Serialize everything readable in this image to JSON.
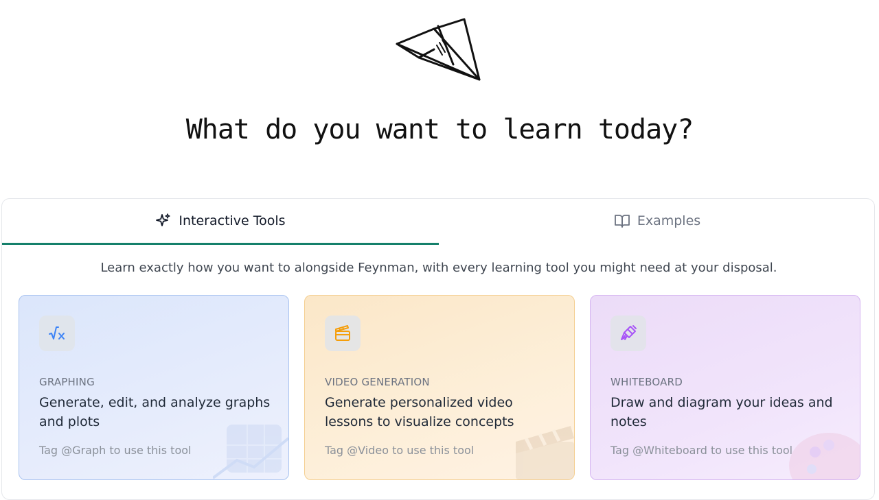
{
  "headline": "What do you want to learn today?",
  "tabs": [
    {
      "label": "Interactive Tools",
      "icon": "sparkles-icon",
      "active": true
    },
    {
      "label": "Examples",
      "icon": "open-book-icon",
      "active": false
    }
  ],
  "intro": "Learn exactly how you want to alongside Feynman, with every learning tool you might need at your disposal.",
  "cards": [
    {
      "label": "GRAPHING",
      "description": "Generate, edit, and analyze graphs and plots",
      "tag": "Tag @Graph to use this tool",
      "icon": "square-root-icon",
      "accent": "#3b82f6"
    },
    {
      "label": "VIDEO GENERATION",
      "description": "Generate personalized video lessons to visualize concepts",
      "tag": "Tag @Video to use this tool",
      "icon": "clapperboard-icon",
      "accent": "#f59e0b"
    },
    {
      "label": "WHITEBOARD",
      "description": "Draw and diagram your ideas and notes",
      "tag": "Tag @Whiteboard to use this tool",
      "icon": "paintbrush-icon",
      "accent": "#a855f7"
    }
  ],
  "colors": {
    "active_tab_underline": "#15806b"
  }
}
